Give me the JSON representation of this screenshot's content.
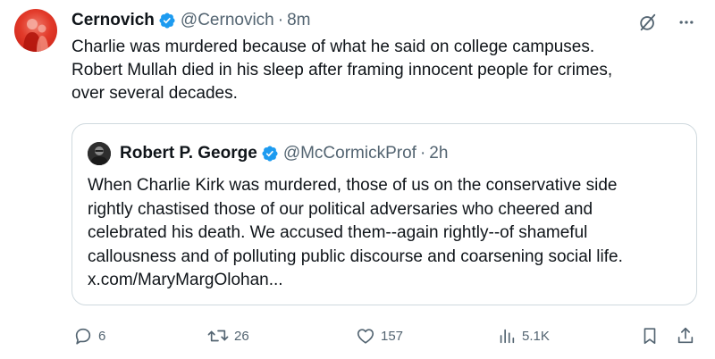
{
  "tweet": {
    "author_name": "Cernovich",
    "handle": "@Cernovich",
    "separator": "·",
    "time": "8m",
    "lines": [
      "Charlie was murdered because of what he said on college campuses.",
      "Robert Mullah died in his sleep after framing innocent people for crimes,",
      "over several decades."
    ]
  },
  "quote": {
    "author_name": "Robert P. George",
    "handle": "@McCormickProf",
    "separator": "·",
    "time": "2h",
    "lines": [
      "When Charlie Kirk was murdered, those of us on the conservative side",
      "rightly chastised those of our political adversaries who cheered and",
      "celebrated his death. We accused them--again rightly--of shameful",
      "callousness and of polluting public discourse and coarsening social life.",
      "x.com/MaryMargOlohan..."
    ]
  },
  "actions": {
    "replies": "6",
    "reposts": "26",
    "likes": "157",
    "views": "5.1K"
  },
  "icons": {
    "verified": "verified-badge-icon",
    "grok": "grok-icon",
    "more": "more-icon",
    "reply": "reply-icon",
    "repost": "repost-icon",
    "like": "like-icon",
    "views": "views-icon",
    "bookmark": "bookmark-icon",
    "share": "share-icon"
  },
  "colors": {
    "verified_blue": "#1d9bf0",
    "muted": "#536471",
    "text": "#0f1419",
    "border": "#cfd9de",
    "avatar_red": "#e23a2a"
  }
}
